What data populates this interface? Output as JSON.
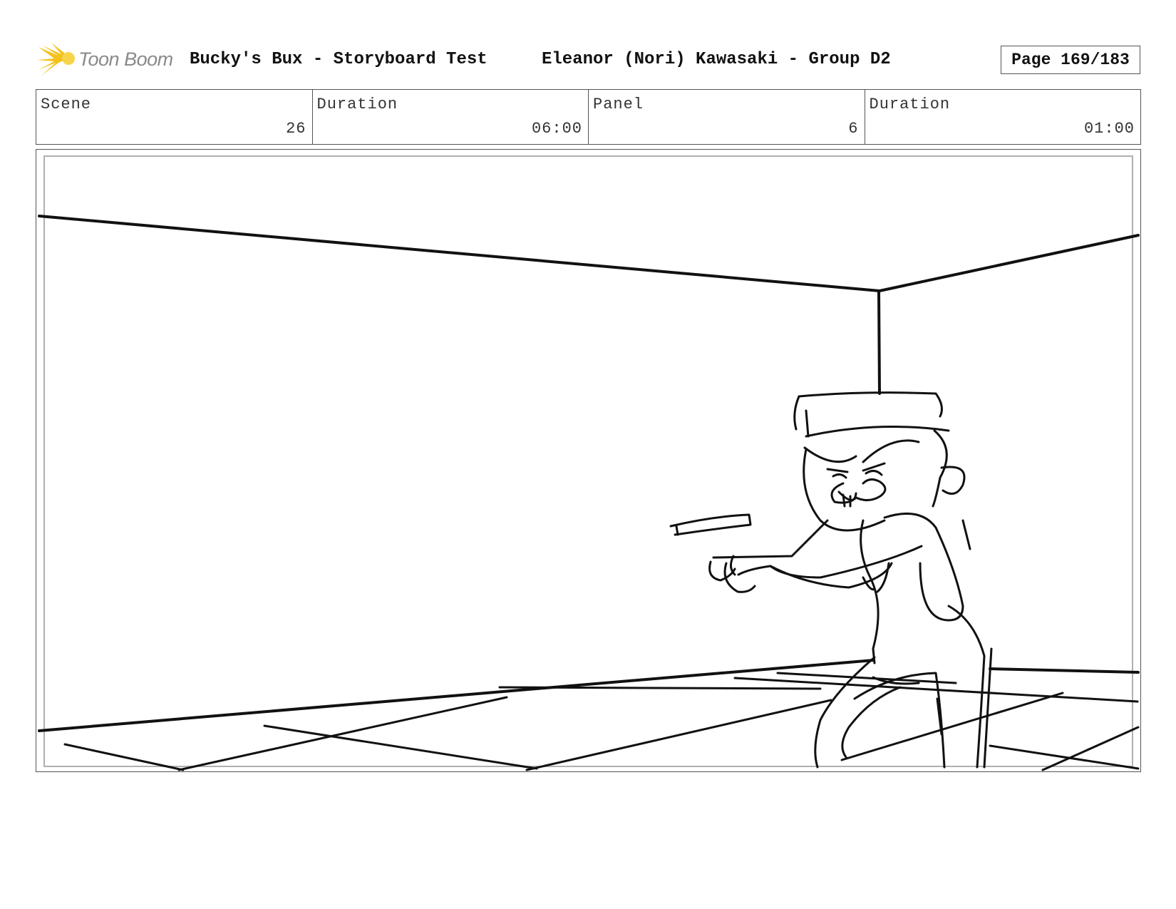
{
  "header": {
    "logo_text": "Toon Boom",
    "project_title": "Bucky's Bux - Storyboard Test",
    "artist_title": "Eleanor (Nori) Kawasaki - Group D2",
    "page": "Page 169/183"
  },
  "info": {
    "scene_label": "Scene",
    "scene_value": "26",
    "scene_duration_label": "Duration",
    "scene_duration_value": "06:00",
    "panel_label": "Panel",
    "panel_value": "6",
    "panel_duration_label": "Duration",
    "panel_duration_value": "01:00"
  },
  "colors": {
    "logo_burst": "#f5c21b",
    "logo_text": "#8a8a8a",
    "line_art": "#111111"
  }
}
